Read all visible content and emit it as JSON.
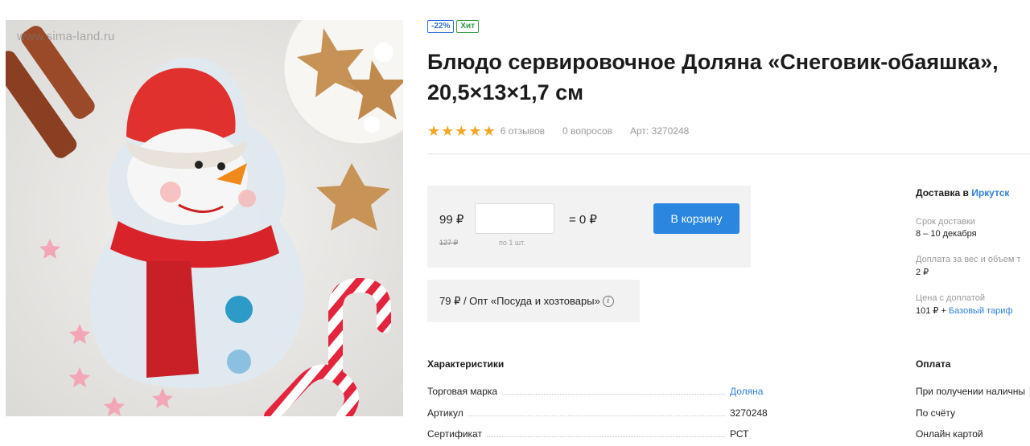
{
  "image": {
    "watermark": "www.sima-land.ru",
    "alt": "Блюдо сервировочное Доляна «Снеговик-обаяшка»"
  },
  "badges": {
    "discount": "-22%",
    "hit": "Хит"
  },
  "product": {
    "title": "Блюдо сервировочное Доляна «Снеговик-обаяшка», 20,5×13×1,7 см",
    "rating": 5,
    "reviews": "6 отзывов",
    "questions": "0 вопросов",
    "article": "Арт: 3270248"
  },
  "buy": {
    "price": "99 ₽",
    "old_price": "127 ₽",
    "qty_value": "",
    "per_unit": "по 1 шт.",
    "total": "= 0 ₽",
    "cart_label": "В корзину"
  },
  "wholesale": {
    "text": "79 ₽ / Опт «Посуда и хозтовары»",
    "info_icon": "info-icon"
  },
  "characteristics": {
    "title": "Характеристики",
    "rows": [
      {
        "key": "Торговая марка",
        "value": "Доляна"
      },
      {
        "key": "Артикул",
        "value": "3270248"
      },
      {
        "key": "Сертификат",
        "value": "РСТ"
      }
    ]
  },
  "delivery": {
    "title_prefix": "Доставка в",
    "city": "Иркутск",
    "term_label": "Срок доставки",
    "term_value": "8 – 10 декабря",
    "surcharge_label": "Доплата за вес и объем т",
    "surcharge_value": "2 ₽",
    "total_label": "Цена с доплатой",
    "total_value_prefix": "101 ₽ +",
    "tariff": "Базовый тариф"
  },
  "payment": {
    "title": "Оплата",
    "items": [
      "При получении наличны",
      "По счёту",
      "Онлайн картой"
    ]
  },
  "colors": {
    "accent": "#2b86e0",
    "star": "#f5a623",
    "badge_discount": "#2f6fd8",
    "badge_hit": "#2ea043"
  }
}
